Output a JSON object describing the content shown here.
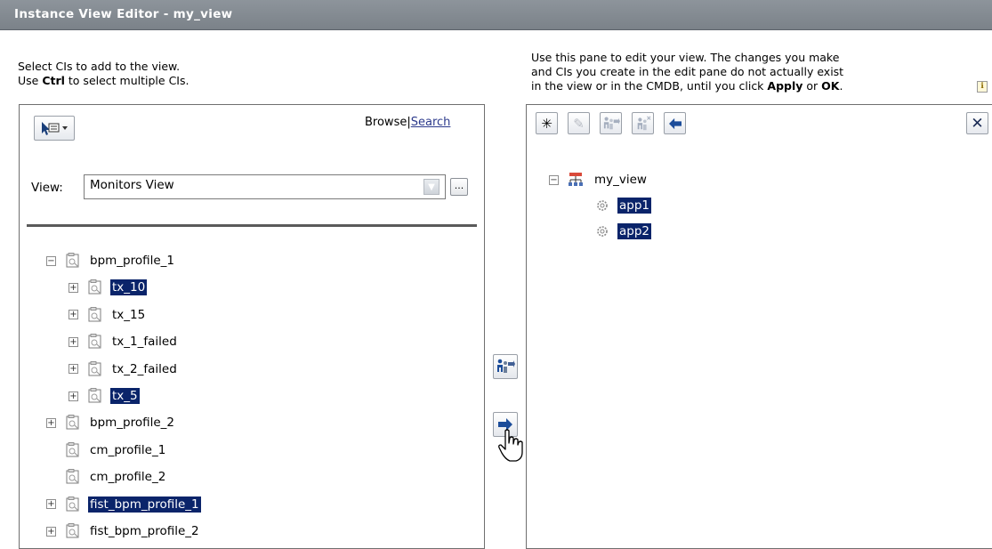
{
  "window": {
    "title": "Instance View Editor - my_view"
  },
  "left_instructions": {
    "line1": "Select CIs to add to the view.",
    "line2_pre": "Use ",
    "line2_key": "Ctrl",
    "line2_post": " to select multiple CIs."
  },
  "right_instructions": {
    "line1": "Use this pane to edit your view. The changes you make",
    "line2": "and CIs you create in the edit pane do not actually exist",
    "line3_pre": "in the view or in the CMDB, until you click ",
    "apply": "Apply",
    "or": " or ",
    "ok": "OK",
    "period": "."
  },
  "browse_panel": {
    "browse_label": "Browse",
    "separator": "|",
    "search_label": "Search",
    "view_label": "View:",
    "view_value": "Monitors View",
    "more_label": "..."
  },
  "left_tree": [
    {
      "label": "bpm_profile_1",
      "level": 0,
      "expander": "minus",
      "selected": false
    },
    {
      "label": "tx_10",
      "level": 1,
      "expander": "plus",
      "selected": true
    },
    {
      "label": "tx_15",
      "level": 1,
      "expander": "plus",
      "selected": false
    },
    {
      "label": "tx_1_failed",
      "level": 1,
      "expander": "plus",
      "selected": false
    },
    {
      "label": "tx_2_failed",
      "level": 1,
      "expander": "plus",
      "selected": false
    },
    {
      "label": "tx_5",
      "level": 1,
      "expander": "plus",
      "selected": true
    },
    {
      "label": "bpm_profile_2",
      "level": 0,
      "expander": "plus",
      "selected": false
    },
    {
      "label": "cm_profile_1",
      "level": 0,
      "expander": "none",
      "selected": false
    },
    {
      "label": "cm_profile_2",
      "level": 0,
      "expander": "none",
      "selected": false
    },
    {
      "label": "fist_bpm_profile_1",
      "level": 0,
      "expander": "plus",
      "selected": true
    },
    {
      "label": "fist_bpm_profile_2",
      "level": 0,
      "expander": "plus",
      "selected": false
    }
  ],
  "right_tree": {
    "root": "my_view",
    "children": [
      {
        "label": "app1",
        "selected": true
      },
      {
        "label": "app2",
        "selected": true
      }
    ]
  },
  "edit_toolbar": {
    "buttons": [
      {
        "icon": "asterisk-icon",
        "glyph": "✳"
      },
      {
        "icon": "pencil-icon",
        "glyph": "✎"
      },
      {
        "icon": "add-related-icon",
        "glyph": ""
      },
      {
        "icon": "remove-related-icon",
        "glyph": ""
      },
      {
        "icon": "back-arrow-icon",
        "glyph": ""
      }
    ],
    "close_glyph": "✕"
  },
  "colors": {
    "selection": "#0a246a",
    "titlebar": "#848b92",
    "link": "#2c3a8c"
  }
}
